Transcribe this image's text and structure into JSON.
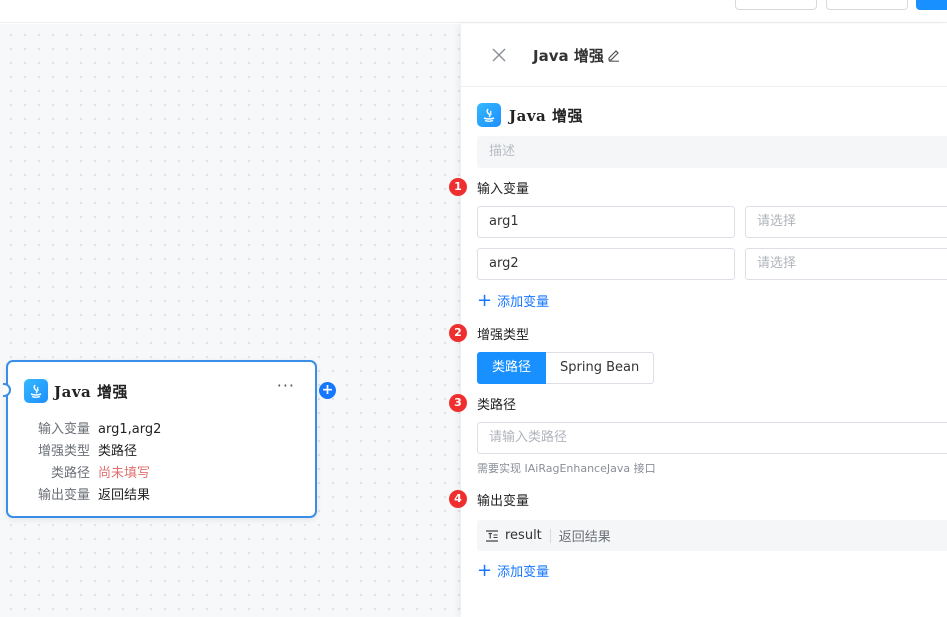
{
  "canvas": {
    "node": {
      "title": "Java 增强",
      "more": "···",
      "add": "+",
      "rows": [
        {
          "key": "输入变量",
          "value": "arg1,arg2"
        },
        {
          "key": "增强类型",
          "value": "类路径"
        },
        {
          "key": "类路径",
          "value": "尚未填写"
        },
        {
          "key": "输出变量",
          "value": "返回结果"
        }
      ]
    }
  },
  "panel": {
    "header_title": "Java 增强",
    "node_title": "Java 增强",
    "description_placeholder": "描述",
    "sections": {
      "input": {
        "badge": "1",
        "label": "输入变量"
      },
      "enhance_type": {
        "badge": "2",
        "label": "增强类型"
      },
      "class_path": {
        "badge": "3",
        "label": "类路径"
      },
      "output": {
        "badge": "4",
        "label": "输出变量"
      }
    },
    "inputs": [
      {
        "name": "arg1",
        "select_placeholder": "请选择"
      },
      {
        "name": "arg2",
        "select_placeholder": "请选择"
      }
    ],
    "add_variable": "添加变量",
    "enhance_options": [
      "类路径",
      "Spring Bean"
    ],
    "enhance_selected": "类路径",
    "class_path_placeholder": "请输入类路径",
    "class_path_hint": "需要实现 IAiRagEnhanceJava 接口",
    "outputs": [
      {
        "name": "result",
        "desc": "返回结果"
      }
    ]
  },
  "colors": {
    "accent": "#1890ff",
    "node_border": "#3a8ee6",
    "badge": "#ef2f2f",
    "warn_text": "#e07070"
  }
}
